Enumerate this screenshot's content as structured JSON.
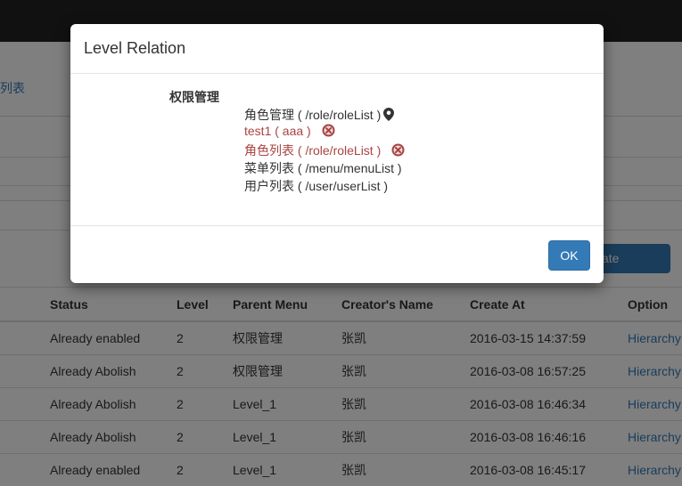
{
  "background": {
    "breadcrumb": "列表",
    "create_button": "ate",
    "table": {
      "headers": [
        "",
        "Status",
        "Level",
        "Parent Menu",
        "Creator's Name",
        "Create At",
        "Option"
      ],
      "rows": [
        {
          "status": "Already enabled",
          "level": "2",
          "parent": "权限管理",
          "creator": "张凯",
          "created": "2016-03-15 14:37:59",
          "option": "Hierarchy"
        },
        {
          "status": "Already Abolish",
          "level": "2",
          "parent": "权限管理",
          "creator": "张凯",
          "created": "2016-03-08 16:57:25",
          "option": "Hierarchy"
        },
        {
          "status": "Already Abolish",
          "level": "2",
          "parent": "Level_1",
          "creator": "张凯",
          "created": "2016-03-08 16:46:34",
          "option": "Hierarchy"
        },
        {
          "status": "Already Abolish",
          "level": "2",
          "parent": "Level_1",
          "creator": "张凯",
          "created": "2016-03-08 16:46:16",
          "option": "Hierarchy"
        },
        {
          "status": "Already enabled",
          "level": "2",
          "parent": "Level_1",
          "creator": "张凯",
          "created": "2016-03-08 16:45:17",
          "option": "Hierarchy"
        }
      ]
    }
  },
  "modal": {
    "title": "Level Relation",
    "root": "权限管理",
    "items": [
      {
        "label": "角色管理 ( /role/roleList )",
        "icon": "map-marker-icon",
        "style": "normal"
      },
      {
        "label": "test1 ( aaa )",
        "icon": "remove-circle-icon",
        "style": "red"
      },
      {
        "label": "角色列表 ( /role/roleList )",
        "icon": "remove-circle-icon",
        "style": "red"
      },
      {
        "label": "菜单列表 ( /menu/menuList )",
        "icon": "",
        "style": "normal"
      },
      {
        "label": "用户列表 ( /user/userList )",
        "icon": "",
        "style": "normal"
      }
    ],
    "ok_label": "OK"
  },
  "colors": {
    "primary": "#337ab7",
    "danger": "#a94442",
    "topbar": "#222222"
  }
}
